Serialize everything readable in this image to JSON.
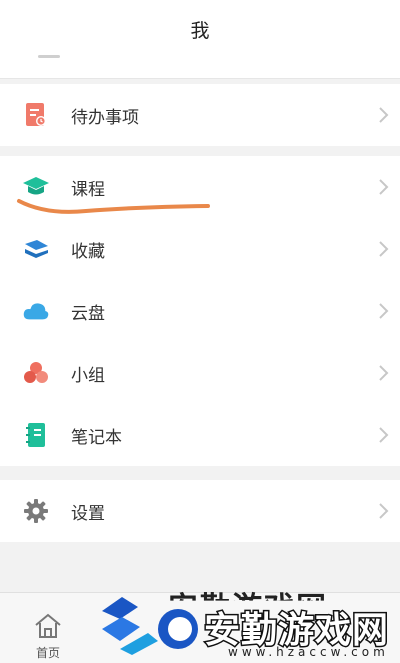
{
  "header": {
    "title": "我"
  },
  "menu": {
    "group1": [
      {
        "label": "待办事项",
        "icon": "todo-icon"
      }
    ],
    "group2": [
      {
        "label": "课程",
        "icon": "course-icon"
      },
      {
        "label": "收藏",
        "icon": "favorites-icon"
      },
      {
        "label": "云盘",
        "icon": "cloud-disk-icon"
      },
      {
        "label": "小组",
        "icon": "group-icon"
      },
      {
        "label": "笔记本",
        "icon": "notebook-icon"
      }
    ],
    "group3": [
      {
        "label": "设置",
        "icon": "gear-icon"
      }
    ]
  },
  "tabbar": {
    "home_label": "首页"
  },
  "watermark": {
    "name": "安勤游戏网",
    "url": "www.hzaccw.com"
  },
  "colors": {
    "todo": "#f07a6a",
    "course": "#1fbf9a",
    "favorites": "#2f86d6",
    "cloud": "#3aa8e6",
    "group": "#ef6f5f",
    "notebook": "#1fbf9a",
    "settings": "#7a7a7a",
    "highlight_stroke": "#e9884a"
  }
}
